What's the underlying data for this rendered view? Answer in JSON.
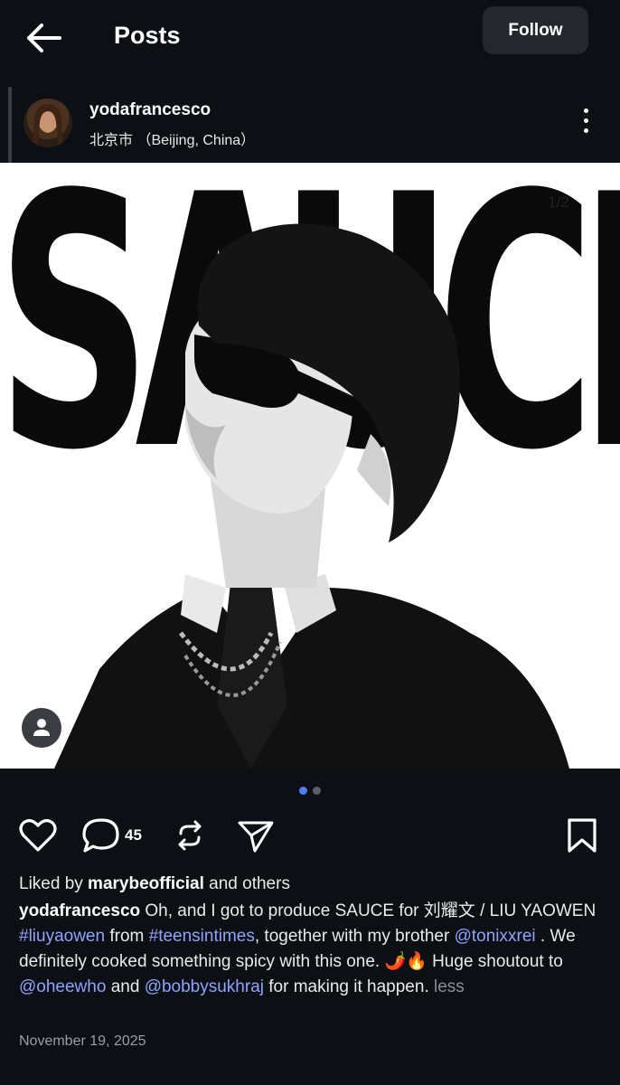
{
  "header": {
    "title": "Posts",
    "follow_label": "Follow",
    "back_icon": "arrow-left-icon"
  },
  "post": {
    "username": "yodafrancesco",
    "location": "北京市 （Beijing, China）",
    "image_text": "SAUCE",
    "image_counter": "1/2",
    "carousel": {
      "count": 2,
      "active": 1
    },
    "actions": {
      "comments_count": "45"
    },
    "liked_by": {
      "prefix": "Liked by ",
      "user": "marybeofficial",
      "suffix": " and others"
    },
    "caption": {
      "author": "yodafrancesco",
      "p1": " Oh, and I got to produce SAUCE for 刘耀文 / LIU YAOWEN ",
      "tag1": "#liuyaowen",
      "p2": " from ",
      "tag2": "#teensintimes",
      "p3": ", together with my brother ",
      "mention1": "@tonixxrei",
      "p4": " . We definitely cooked something spicy with this one. 🌶️🔥 Huge shoutout to ",
      "mention2": "@oheewho",
      "p5": " and ",
      "mention3": "@bobbysukhraj",
      "p6": " for making it happen. ",
      "less_label": "less"
    },
    "date": "November 19, 2025"
  },
  "colors": {
    "background": "#0c0f13",
    "link": "#8fa3ff",
    "active_dot": "#4f7cf7"
  }
}
